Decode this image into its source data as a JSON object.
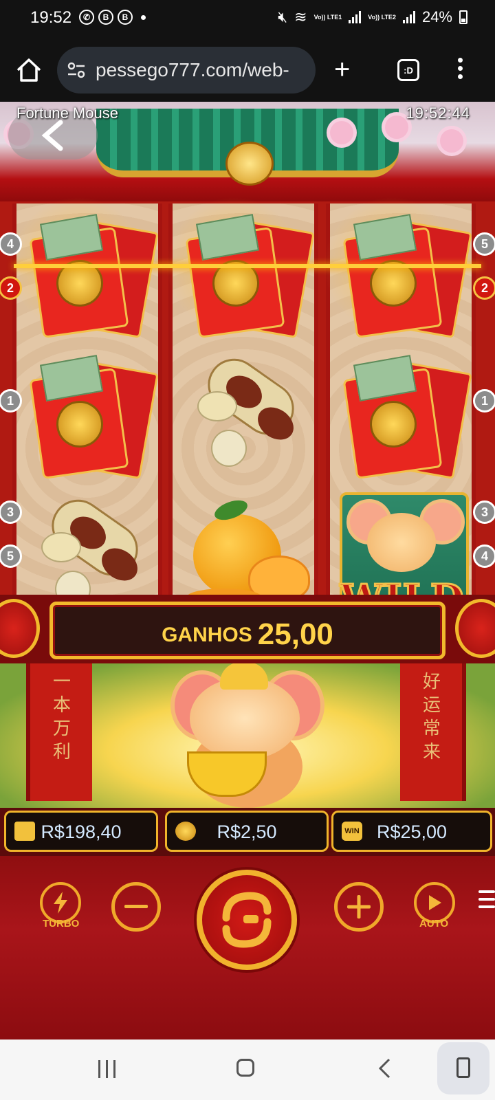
{
  "status_bar": {
    "time": "19:52",
    "left_icons": [
      "whatsapp-icon",
      "b-icon",
      "b-icon",
      "dot-icon"
    ],
    "lte1": "Vo)) LTE1",
    "lte2": "Vo)) LTE2",
    "battery": "24%"
  },
  "browser": {
    "url": "pessego777.com/web-",
    "tab_label": ":D"
  },
  "game": {
    "title": "Fortune Mouse",
    "clock": "19:52:44",
    "reels": [
      [
        "red-envelope",
        "red-envelope",
        "peanut"
      ],
      [
        "red-envelope",
        "peanut",
        "orange"
      ],
      [
        "red-envelope",
        "red-envelope",
        "wild-mouse"
      ]
    ],
    "wild_text": "WILD",
    "line_badges_left": [
      "4",
      "2",
      "1",
      "3",
      "5"
    ],
    "line_badges_right": [
      "5",
      "2",
      "1",
      "3",
      "4"
    ],
    "winning_line": "2",
    "win_label": "GANHOS",
    "win_amount": "25,00",
    "pillar_left_text": "一本万利",
    "pillar_right_text": "好运常来",
    "balance": "R$198,40",
    "bet": "R$2,50",
    "win": "R$25,00",
    "win_badge": "WIN",
    "turbo_label": "TURBO",
    "auto_label": "AUTO"
  },
  "colors": {
    "gold": "#f1b52b",
    "red": "#a9151a",
    "balance_text": "#d4e9ff",
    "win_text": "#ffd34a"
  }
}
